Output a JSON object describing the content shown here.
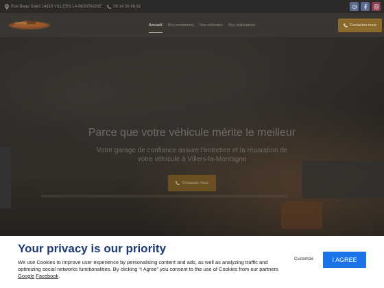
{
  "topbar": {
    "address": "Rue Beau Soleil 14310 VILLERS LA MONTAGNE",
    "phone": "06 14 56 46 91",
    "socials": [
      {
        "name": "google",
        "color": "#5d6b8a"
      },
      {
        "name": "facebook",
        "color": "#5b6b8e"
      },
      {
        "name": "instagram",
        "color": "#8a3e52"
      }
    ]
  },
  "nav": {
    "logo_text": "Garage",
    "menu": [
      "Accueil",
      "Nos prestations",
      "Nos véhicules",
      "Nos réalisations"
    ],
    "contact_label": "Contactez-nous"
  },
  "hero": {
    "title": "Parce que votre véhicule mérite le meilleur",
    "subtitle": "Votre garage de confiance assure l'entretien et la réparation de votre véhicule à Villers-la-Montagne",
    "button_label": "Contactez-nous"
  },
  "cookie": {
    "title": "Your privacy is our priority",
    "text_before": "We use Cookies to improve user experience by personalising content and ads, as well as analyzing traffic and optimizing social networks functionalities. By clicking “I Agree” you consent to the use of Cookies from our partners ",
    "link_google": "Google",
    "link_facebook": "Facebook",
    "text_after": ".",
    "customize_label": "Customize",
    "agree_label": "I AGREE"
  },
  "colors": {
    "accent": "#8a6a2c",
    "cookie_title": "#1d3b72",
    "agree_button": "#1a73e8"
  }
}
